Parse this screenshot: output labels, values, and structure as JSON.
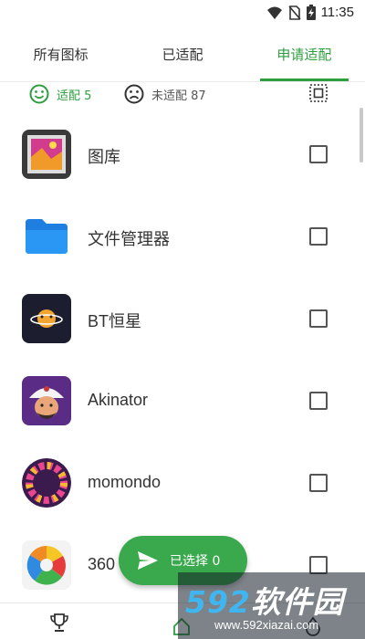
{
  "status_bar": {
    "time": "11:35",
    "icons": [
      "wifi-icon",
      "no-sim-icon",
      "battery-charging-icon"
    ]
  },
  "tabs": [
    {
      "label": "所有图标",
      "active": false
    },
    {
      "label": "已适配",
      "active": false
    },
    {
      "label": "申请适配",
      "active": true
    }
  ],
  "stats": {
    "adapted_label": "适配 5",
    "unadapted_label": "未适配 87"
  },
  "apps": [
    {
      "name": "图库",
      "icon": "gallery-icon",
      "checked": false
    },
    {
      "name": "文件管理器",
      "icon": "folder-icon",
      "checked": false
    },
    {
      "name": "BT恒星",
      "icon": "planet-icon",
      "checked": false
    },
    {
      "name": "Akinator",
      "icon": "genie-icon",
      "checked": false
    },
    {
      "name": "momondo",
      "icon": "momondo-icon",
      "checked": false
    },
    {
      "name": "360",
      "icon": "360-icon",
      "checked": false
    }
  ],
  "fab": {
    "label": "已选择 0",
    "icon": "send-icon"
  },
  "bottom_nav": {
    "items": [
      "trophy-icon",
      "home-icon",
      "drop-icon"
    ]
  },
  "watermark": {
    "number": "592",
    "text": "软件园",
    "url": "www.592xiazai.com"
  },
  "colors": {
    "accent": "#2e9e41",
    "fab": "#3aa84c"
  }
}
